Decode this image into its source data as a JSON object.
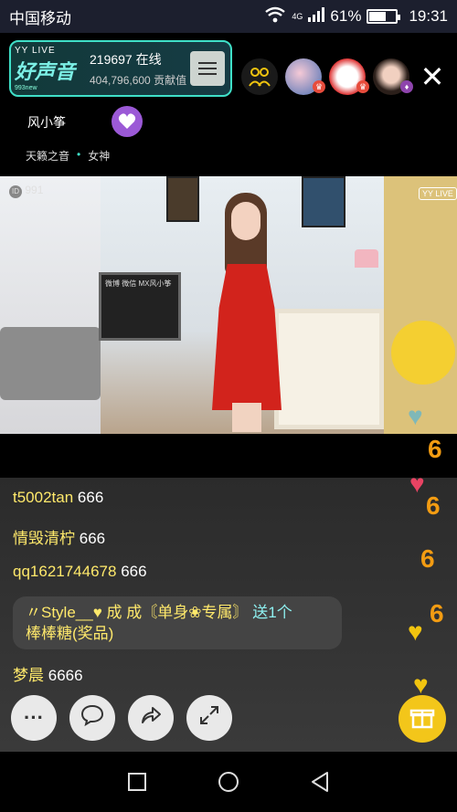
{
  "status": {
    "carrier": "中国移动",
    "network": "4G",
    "battery_pct": "61%",
    "battery_level": 0.61,
    "time": "19:31"
  },
  "channel": {
    "logo_top": "YY LIVE",
    "logo_main": "好声音",
    "logo_sub": "993new",
    "online": "219697 在线",
    "contribution": "404,796,600 贡献值"
  },
  "anchor": {
    "name": "风小筝",
    "tags": [
      "天籁之音",
      "•",
      "女神"
    ]
  },
  "video": {
    "room_id": "991",
    "watermark": "YY LIVE",
    "board_text": "微博 微信 MX风小筝"
  },
  "chat": {
    "messages": [
      {
        "user": "t5002tan",
        "text": "666"
      },
      {
        "user": "情毁清柠",
        "text": "666"
      },
      {
        "user": "qq1621744678",
        "text": "666"
      }
    ],
    "gift": {
      "prefix": "〃Style__♥ 成 成〘单身❀专属〙",
      "action": "送1个",
      "item": "棒棒糖(奖品)"
    },
    "last": {
      "user": "梦晨",
      "text": "6666"
    }
  },
  "controls": {
    "more": "···",
    "close": "✕"
  },
  "colors": {
    "accent_teal": "#3fe0c8",
    "user_yellow": "#ffe96b",
    "gift_yellow": "#f3c61a",
    "heart_purple": "#9b59d6"
  }
}
